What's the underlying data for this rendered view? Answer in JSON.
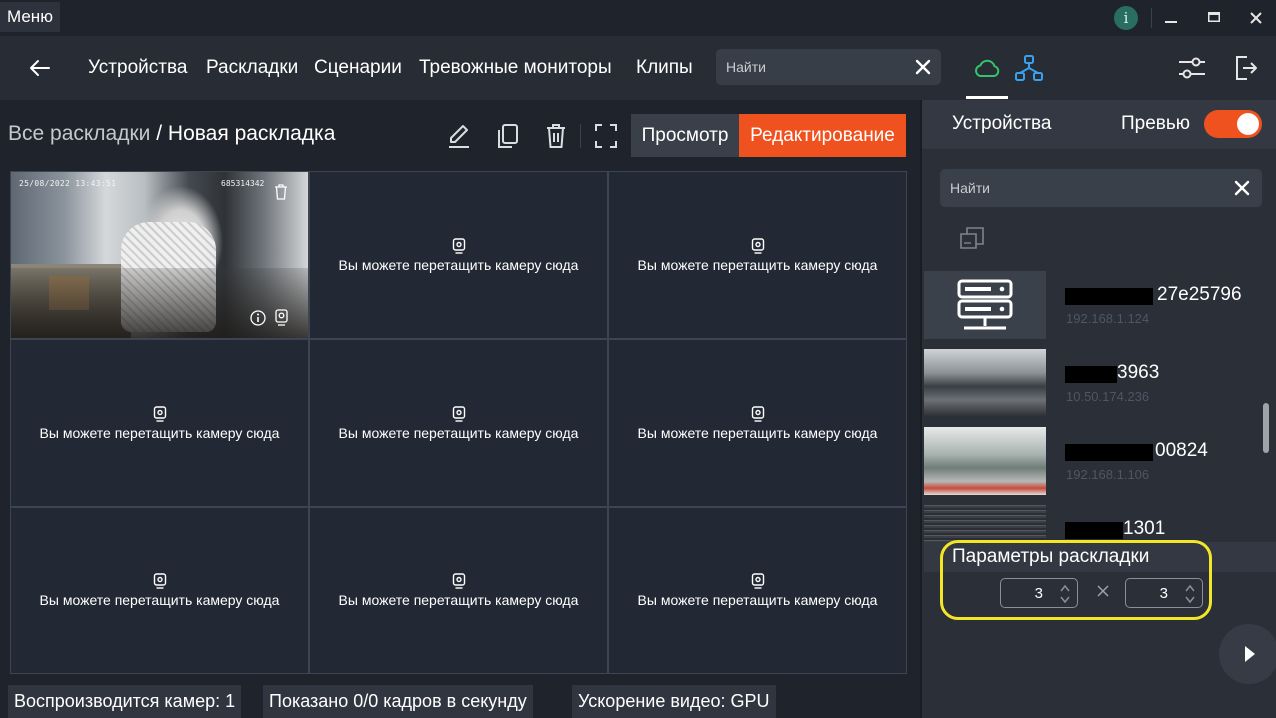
{
  "titlebar": {
    "menu_label": "Меню",
    "info_label": "i",
    "minimize": "—",
    "maximize": "■",
    "close": "✕"
  },
  "nav": {
    "items": [
      "Устройства",
      "Раскладки",
      "Сценарии",
      "Тревожные мониторы",
      "Клипы"
    ],
    "search_placeholder": "Найти"
  },
  "layout": {
    "breadcrumb_root": "Все раскладки",
    "breadcrumb_sep": " / ",
    "breadcrumb_current": "Новая раскладка",
    "view_label": "Просмотр",
    "edit_label": "Редактирование",
    "drop_hint": "Вы можете перетащить камеру сюда",
    "camera_overlay": {
      "timestamp": "25/08/2022 13:43:51",
      "serial": "685314342"
    }
  },
  "status_bar": {
    "playing": "Воспроизводится камер: 1",
    "fps": "Показано 0/0 кадров в секунду",
    "accel": "Ускорение видео: GPU"
  },
  "right_panel": {
    "title": "Устройства",
    "preview_label": "Превью",
    "preview_on": true,
    "search_placeholder": "Найти",
    "devices": [
      {
        "name": "27e25796",
        "ip": "192.168.1.124",
        "thumb": "server-icon"
      },
      {
        "name": "3963",
        "ip": "10.50.174.236",
        "thumb": "camera-frame"
      },
      {
        "name": "00824",
        "ip": "192.168.1.106",
        "thumb": "camera-frame"
      },
      {
        "name": "1301",
        "ip": "",
        "thumb": "camera-frame"
      }
    ],
    "params": {
      "title": "Параметры раскладки",
      "rows": "3",
      "cols": "3",
      "times": "×"
    }
  },
  "colors": {
    "accent": "#f0521f",
    "cloud": "#35c46a",
    "network": "#3aa0f0",
    "highlight": "#f3e627"
  }
}
